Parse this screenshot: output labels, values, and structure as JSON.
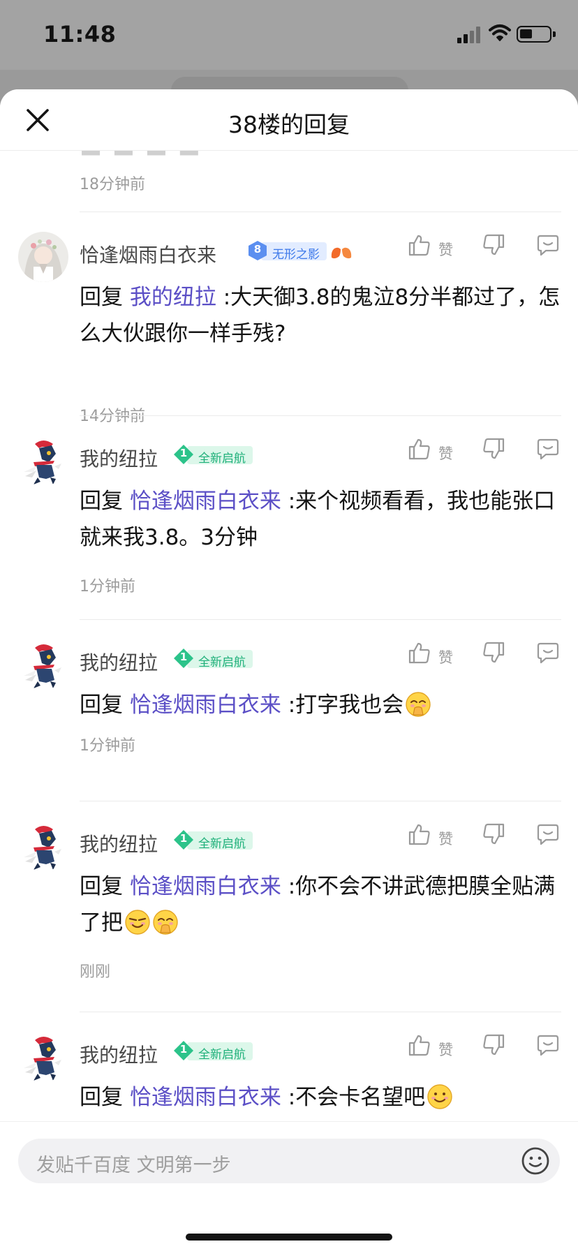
{
  "status_bar": {
    "time": "11:48"
  },
  "sheet": {
    "title": "38楼的回复"
  },
  "previous_comment": {
    "time": "18分钟前"
  },
  "like_label": "赞",
  "comments": [
    {
      "author": "恰逢烟雨白衣来",
      "level": "8",
      "level_title": "无形之影",
      "badge_color": "blue",
      "reply_prefix": "回复 ",
      "mention": "我的纽拉",
      "text": " :大天御3.8的鬼泣8分半都过了，怎么大伙跟你一样手残?",
      "emojis": [],
      "time": "14分钟前"
    },
    {
      "author": "我的纽拉",
      "level": "1",
      "level_title": "全新启航",
      "badge_color": "green",
      "reply_prefix": "回复 ",
      "mention": "恰逢烟雨白衣来",
      "text": " :来个视频看看，我也能张口就来我3.8。3分钟",
      "emojis": [],
      "time": "1分钟前"
    },
    {
      "author": "我的纽拉",
      "level": "1",
      "level_title": "全新启航",
      "badge_color": "green",
      "reply_prefix": "回复 ",
      "mention": "恰逢烟雨白衣来",
      "text": " :打字我也会",
      "emojis": [
        "shy-laugh-emoji"
      ],
      "time": "1分钟前"
    },
    {
      "author": "我的纽拉",
      "level": "1",
      "level_title": "全新启航",
      "badge_color": "green",
      "reply_prefix": "回复 ",
      "mention": "恰逢烟雨白衣来",
      "text": " :你不会不讲武德把膜全贴满了把",
      "emojis": [
        "smug-emoji",
        "shy-laugh-emoji"
      ],
      "time": "刚刚"
    },
    {
      "author": "我的纽拉",
      "level": "1",
      "level_title": "全新启航",
      "badge_color": "green",
      "reply_prefix": "回复 ",
      "mention": "恰逢烟雨白衣来",
      "text": " :不会卡名望吧",
      "emojis": [
        "smile-emoji"
      ],
      "time": ""
    }
  ],
  "input": {
    "placeholder": "发贴千百度 文明第一步"
  }
}
